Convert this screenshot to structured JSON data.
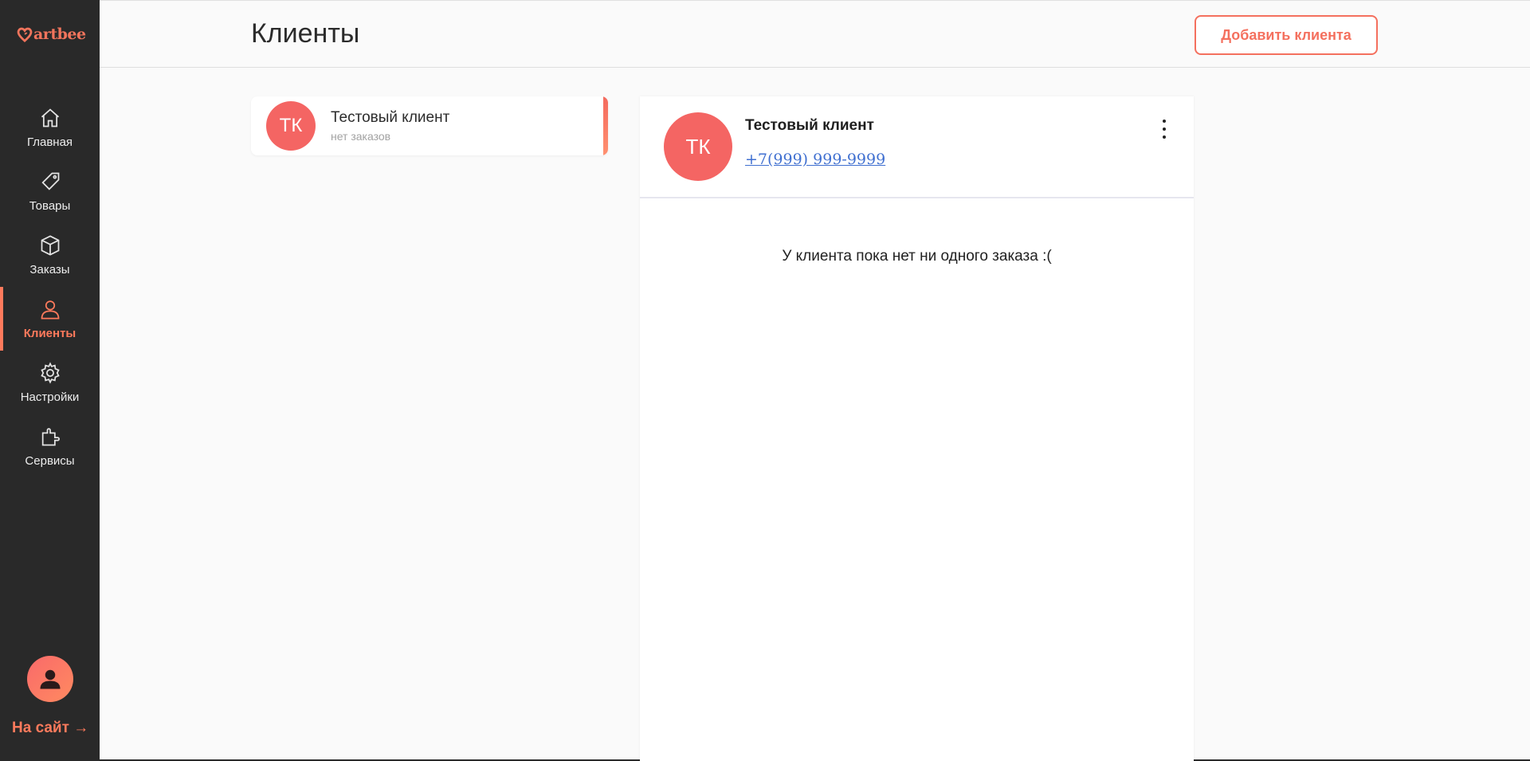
{
  "app": {
    "logo_text": "artbee",
    "brand_color": "#f1745c"
  },
  "sidebar": {
    "items": [
      {
        "label": "Главная",
        "icon": "home-icon",
        "active": false
      },
      {
        "label": "Товары",
        "icon": "tag-icon",
        "active": false
      },
      {
        "label": "Заказы",
        "icon": "box-icon",
        "active": false
      },
      {
        "label": "Клиенты",
        "icon": "user-icon",
        "active": true
      },
      {
        "label": "Настройки",
        "icon": "gear-icon",
        "active": false
      },
      {
        "label": "Сервисы",
        "icon": "puzzle-icon",
        "active": false
      }
    ],
    "site_link": "На сайт →"
  },
  "header": {
    "title": "Клиенты",
    "add_button": "Добавить клиента"
  },
  "client_list": [
    {
      "initials": "ТК",
      "name": "Тестовый клиент",
      "subtitle": "нет заказов"
    }
  ],
  "detail": {
    "initials": "ТК",
    "name": "Тестовый клиент",
    "phone": "+7(999) 999-9999",
    "empty_message": "У клиента пока нет ни одного заказа :("
  },
  "colors": {
    "accent": "#ff7a5c",
    "avatar": "#f46563",
    "link": "#3f6fd0"
  }
}
